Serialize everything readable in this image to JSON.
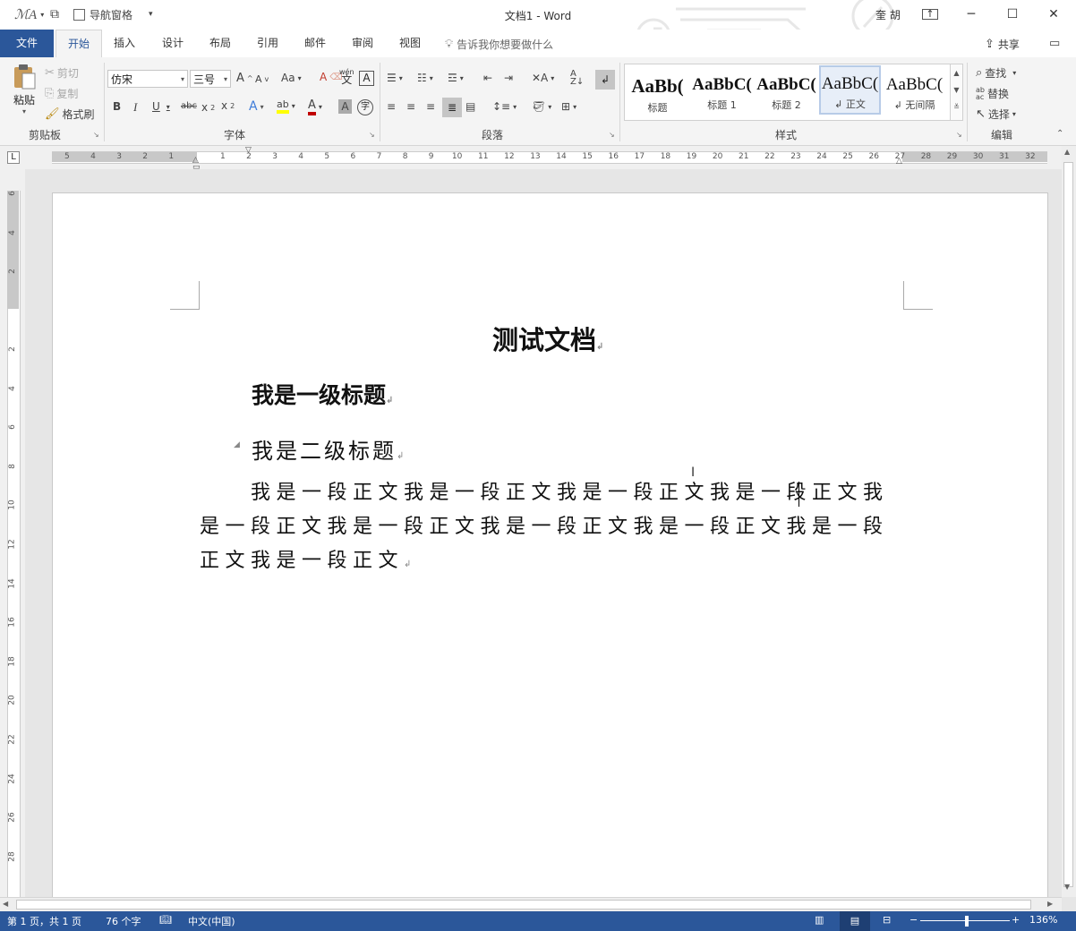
{
  "window": {
    "title": "文档1 - Word",
    "user": "奎 胡",
    "nav_pane_label": "导航窗格"
  },
  "tabs": {
    "file": "文件",
    "items": [
      "开始",
      "插入",
      "设计",
      "布局",
      "引用",
      "邮件",
      "审阅",
      "视图"
    ],
    "tell_me": "告诉我你想要做什么",
    "share": "共享"
  },
  "ribbon": {
    "clipboard": {
      "paste": "粘贴",
      "cut": "剪切",
      "copy": "复制",
      "format_painter": "格式刷",
      "label": "剪贴板"
    },
    "font": {
      "font_name": "仿宋",
      "font_size": "三号",
      "label": "字体",
      "change_case": "Aa",
      "phonetic": "wén 文"
    },
    "paragraph": {
      "label": "段落"
    },
    "styles": {
      "label": "样式",
      "items": [
        {
          "preview": "AaBb(",
          "name": "标题"
        },
        {
          "preview": "AaBbC(",
          "name": "标题 1"
        },
        {
          "preview": "AaBbC(",
          "name": "标题 2"
        },
        {
          "preview": "AaBbC(",
          "name": "↲ 正文"
        },
        {
          "preview": "AaBbC(",
          "name": "↲ 无间隔"
        }
      ]
    },
    "editing": {
      "find": "查找",
      "replace": "替换",
      "select": "选择",
      "label": "编辑"
    }
  },
  "document": {
    "title": "测试文档",
    "heading1": "我是一级标题",
    "heading2": "我是二级标题",
    "body_lines": [
      "　　我是一段正文我是一段正文我是一段正文我是一段正文我",
      "是一段正文我是一段正文我是一段正文我是一段正文我是一段",
      "正文我是一段正文"
    ]
  },
  "ruler": {
    "h_left": [
      "5",
      "4",
      "3",
      "2",
      "1"
    ],
    "h_right": [
      "1",
      "2",
      "3",
      "4",
      "5",
      "6",
      "7",
      "8",
      "9",
      "10",
      "11",
      "12",
      "13",
      "14",
      "15",
      "16",
      "17",
      "18",
      "19",
      "20",
      "21",
      "22",
      "23",
      "24",
      "25",
      "26",
      "27",
      "28",
      "29",
      "30",
      "31",
      "32"
    ],
    "v_top": [
      "6",
      "4",
      "2"
    ],
    "v_bottom": [
      "2",
      "4",
      "6",
      "8",
      "10",
      "12",
      "14",
      "16",
      "18",
      "20",
      "22",
      "24",
      "26",
      "28"
    ]
  },
  "status": {
    "page": "第 1 页，共 1 页",
    "words": "76 个字",
    "language": "中文(中国)",
    "zoom": "136%"
  }
}
